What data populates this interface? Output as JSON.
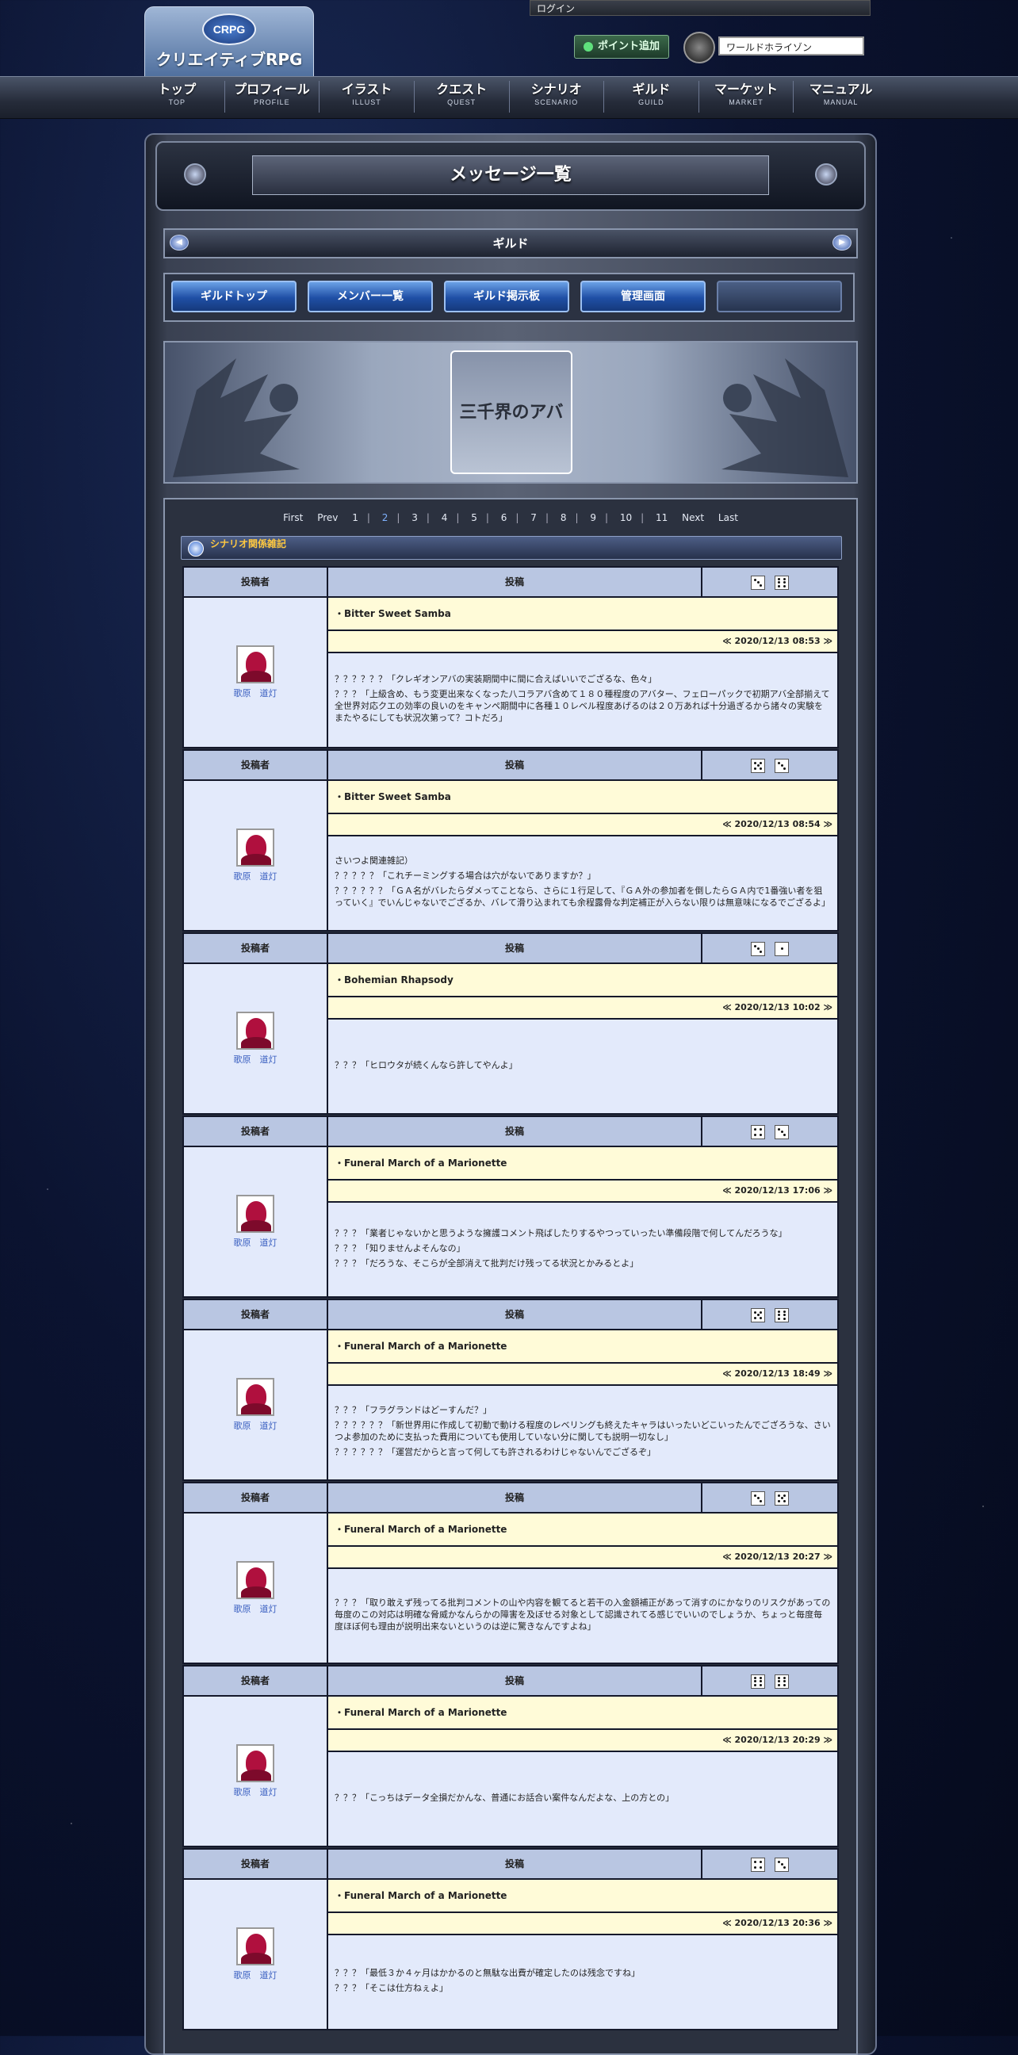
{
  "header": {
    "logo_mark": "CRPG",
    "logo_text": "クリエイティブRPG",
    "login_label": "ログイン",
    "point_button": "ポイント追加",
    "world_select": "ワールドホライゾン"
  },
  "nav": [
    {
      "jp": "トップ",
      "en": "TOP"
    },
    {
      "jp": "プロフィール",
      "en": "PROFILE"
    },
    {
      "jp": "イラスト",
      "en": "ILLUST"
    },
    {
      "jp": "クエスト",
      "en": "QUEST"
    },
    {
      "jp": "シナリオ",
      "en": "SCENARIO"
    },
    {
      "jp": "ギルド",
      "en": "GUILD"
    },
    {
      "jp": "マーケット",
      "en": "MARKET"
    },
    {
      "jp": "マニュアル",
      "en": "MANUAL"
    }
  ],
  "page_title": "メッセージ一覧",
  "section_title": "ギルド",
  "guild_buttons": [
    "ギルドトップ",
    "メンバー一覧",
    "ギルド掲示板",
    "管理画面",
    ""
  ],
  "banner_text": "三千界のアバター",
  "pager": {
    "first": "First",
    "prev": "Prev",
    "pages": [
      "1",
      "2",
      "3",
      "4",
      "5",
      "6",
      "7",
      "8",
      "9",
      "10",
      "11"
    ],
    "current": "2",
    "next": "Next",
    "last": "Last"
  },
  "thread_title": "シナリオ関係雑記",
  "table_headers": {
    "poster": "投稿者",
    "post": "投稿"
  },
  "posts": [
    {
      "poster": "歌原　道灯",
      "subject": "・Bitter Sweet Samba",
      "date": "≪ 2020/12/13 08:53 ≫",
      "dice": [
        3,
        6
      ],
      "lines": [
        "？？？？？？「クレギオンアバの実装期間中に間に合えばいいでござるな、色々」",
        "？？？「上級含め、もう変更出来なくなった八コラアバ含めて１８０種程度のアバター、フェローパックで初期アバ全部揃えて全世界対応クエの効率の良いのをキャンペ期間中に各種１０レベル程度あげるのは２０万あれば十分過ぎるから諸々の実験をまたやるにしても状況次第って？コトだろ」"
      ]
    },
    {
      "poster": "歌原　道灯",
      "subject": "・Bitter Sweet Samba",
      "date": "≪ 2020/12/13 08:54 ≫",
      "dice": [
        5,
        3
      ],
      "lines": [
        "さいつよ関連雑記）",
        "？？？？？「これチーミングする場合は穴がないでありますか？」",
        "？？？？？？「ＧＡ名がバレたらダメってことなら、さらに１行足して、『ＧＡ外の参加者を倒したらＧＡ内で1番強い者を狙っていく』でいんじゃないでござるか、バレて滑り込まれても余程露骨な判定補正が入らない限りは無意味になるでござるよ」"
      ]
    },
    {
      "poster": "歌原　道灯",
      "subject": "・Bohemian Rhapsody",
      "date": "≪ 2020/12/13 10:02 ≫",
      "dice": [
        3,
        1
      ],
      "lines": [
        "？？？「ヒロウタが続くんなら許してやんよ」"
      ]
    },
    {
      "poster": "歌原　道灯",
      "subject": "・Funeral March of a Marionette",
      "date": "≪ 2020/12/13 17:06 ≫",
      "dice": [
        4,
        3
      ],
      "lines": [
        "？？？「業者じゃないかと思うような擁護コメント飛ばしたりするやつっていったい準備段階で何してんだろうな」",
        "？？？「知りませんよそんなの」",
        "？？？「だろうな、そこらが全部消えて批判だけ残ってる状況とかみるとよ」"
      ]
    },
    {
      "poster": "歌原　道灯",
      "subject": "・Funeral March of a Marionette",
      "date": "≪ 2020/12/13 18:49 ≫",
      "dice": [
        5,
        6
      ],
      "lines": [
        "？？？「フラグランドはどーすんだ？」",
        "？？？？？？「新世界用に作成して初動で動ける程度のレベリングも終えたキャラはいったいどこいったんでござろうな、さいつよ参加のために支払った費用についても使用していない分に関しても説明一切なし」",
        "？？？？？？「運営だからと言って何しても許されるわけじゃないんでござるぞ」"
      ]
    },
    {
      "poster": "歌原　道灯",
      "subject": "・Funeral March of a Marionette",
      "date": "≪ 2020/12/13 20:27 ≫",
      "dice": [
        3,
        5
      ],
      "lines": [
        "？？？「取り敢えず残ってる批判コメントの山や内容を観てると若干の入金額補正があって消すのにかなりのリスクがあっての毎度のこの対応は明確な脅威かなんらかの障害を及ぼせる対象として認識されてる感じでいいのでしょうか、ちょっと毎度毎度ほぼ何も理由が説明出来ないというのは逆に驚きなんですよね」"
      ]
    },
    {
      "poster": "歌原　道灯",
      "subject": "・Funeral March of a Marionette",
      "date": "≪ 2020/12/13 20:29 ≫",
      "dice": [
        6,
        6
      ],
      "lines": [
        "？？？「こっちはデータ全損だかんな、普通にお話合い案件なんだよな、上の方との」"
      ]
    },
    {
      "poster": "歌原　道灯",
      "subject": "・Funeral March of a Marionette",
      "date": "≪ 2020/12/13 20:36 ≫",
      "dice": [
        4,
        3
      ],
      "lines": [
        "？？？「最低３か４ヶ月はかかるのと無駄な出費が確定したのは残念ですね」",
        "？？？「そこは仕方ねぇよ」"
      ]
    }
  ]
}
